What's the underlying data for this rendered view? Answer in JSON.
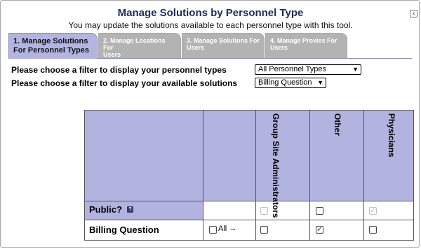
{
  "header": {
    "title": "Manage Solutions by Personnel Type",
    "subtitle": "You may update the solutions available to each personnel type with this tool.",
    "corner_icon": "x"
  },
  "tabs": [
    {
      "line1": "1. Manage Solutions",
      "line2": "For Personnel Types",
      "active": true
    },
    {
      "line1": "2. Manage Locations For",
      "line2": "Users",
      "active": false
    },
    {
      "line1": "3. Manage Solutions For",
      "line2": "Users",
      "active": false
    },
    {
      "line1": "4. Manage Proxies For",
      "line2": "Users",
      "active": false
    }
  ],
  "filters": {
    "personnel_label": "Please choose a filter to display your personnel types",
    "personnel_value": "All Personnel Types",
    "solutions_label": "Please choose a filter to display your available solutions",
    "solutions_value": "Billing Question"
  },
  "grid": {
    "columns": [
      "Group Site Administrators",
      "Other",
      "Physicians"
    ],
    "rows": {
      "public_label": "Public?",
      "public_help": "?",
      "billing_label": "Billing Question",
      "all_label": "All",
      "all_arrow": "→"
    },
    "public_states": [
      "unchecked-disabled",
      "unchecked",
      "checked-disabled"
    ],
    "billing_states": [
      "unchecked",
      "checked",
      "unchecked"
    ],
    "check_glyph": "✓"
  }
}
